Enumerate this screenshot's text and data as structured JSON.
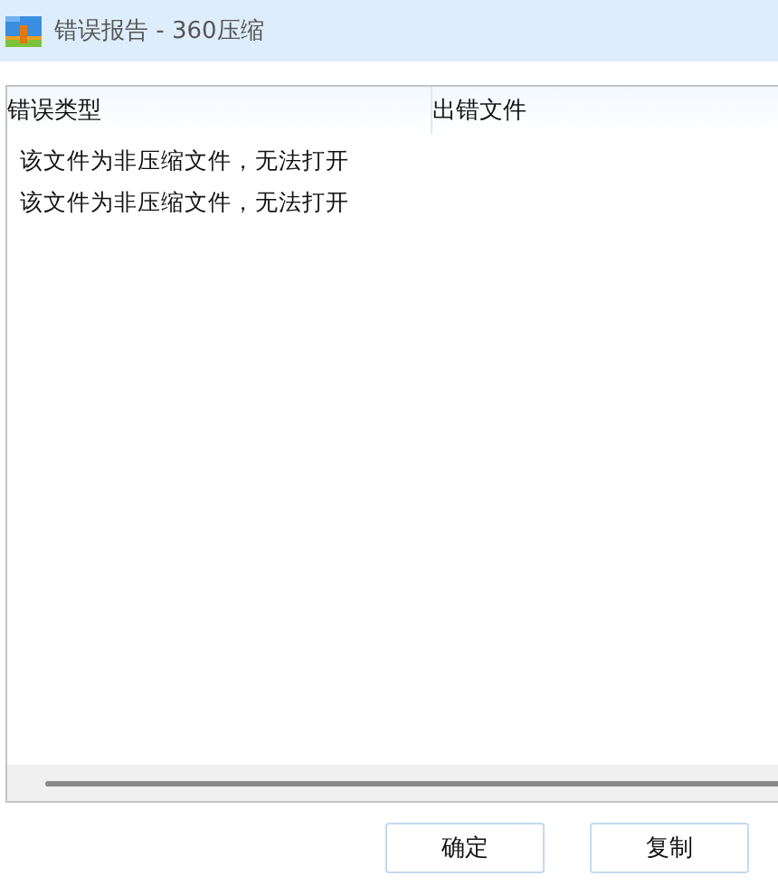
{
  "window": {
    "title": "错误报告 - 360压缩"
  },
  "table": {
    "columns": [
      "错误类型",
      "出错文件"
    ],
    "rows": [
      {
        "cells": [
          "该文件为非压缩文件，无法打开",
          ""
        ]
      },
      {
        "cells": [
          "该文件为非压缩文件，无法打开",
          ""
        ]
      }
    ]
  },
  "buttons": [
    "确定",
    "复制"
  ]
}
